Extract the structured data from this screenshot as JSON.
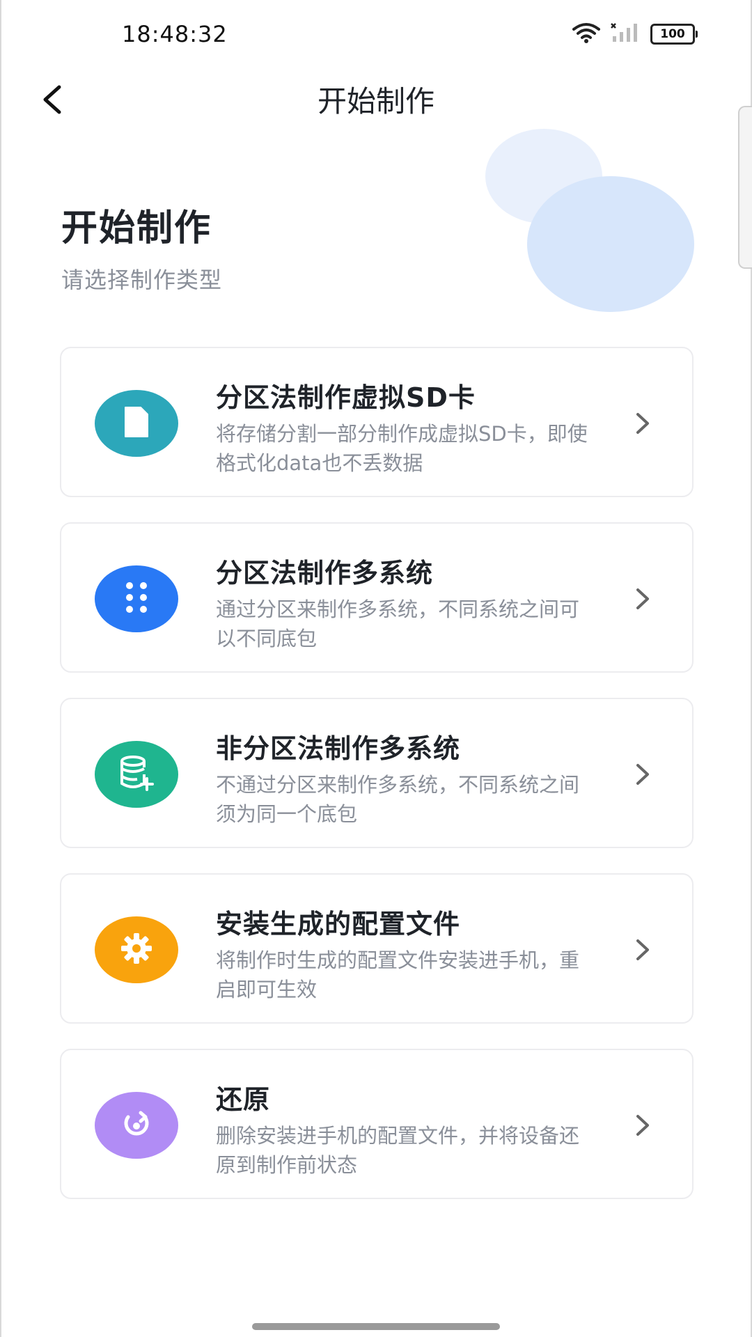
{
  "status_bar": {
    "time": "18:48:32",
    "battery": "100",
    "icons": [
      "wifi-icon",
      "signal-icon",
      "battery-icon"
    ]
  },
  "app_bar": {
    "title": "开始制作",
    "back_icon": "chevron-left-icon"
  },
  "header": {
    "title": "开始制作",
    "subtitle": "请选择制作类型"
  },
  "cards": [
    {
      "title": "分区法制作虚拟SD卡",
      "desc": "将存储分割一部分制作成虚拟SD卡，即使格式化data也不丢数据",
      "icon": "sd-card-icon",
      "color": "#2ca7ba"
    },
    {
      "title": "分区法制作多系统",
      "desc": "通过分区来制作多系统，不同系统之间可以不同底包",
      "icon": "dots-grid-icon",
      "color": "#2979f5"
    },
    {
      "title": "非分区法制作多系统",
      "desc": "不通过分区来制作多系统，不同系统之间须为同一个底包",
      "icon": "database-add-icon",
      "color": "#1fb58f"
    },
    {
      "title": "安装生成的配置文件",
      "desc": "将制作时生成的配置文件安装进手机，重启即可生效",
      "icon": "gear-icon",
      "color": "#f9a30d"
    },
    {
      "title": "还原",
      "desc": "删除安装进手机的配置文件，并将设备还原到制作前状态",
      "icon": "restore-icon",
      "color": "#b18cf5"
    }
  ],
  "colors": {
    "title_text": "#1f2329",
    "secondary_text": "#8a8f99",
    "card_border": "#ececef",
    "bubble_light": "#e9f0fc",
    "bubble_dark": "#d7e6fb"
  }
}
